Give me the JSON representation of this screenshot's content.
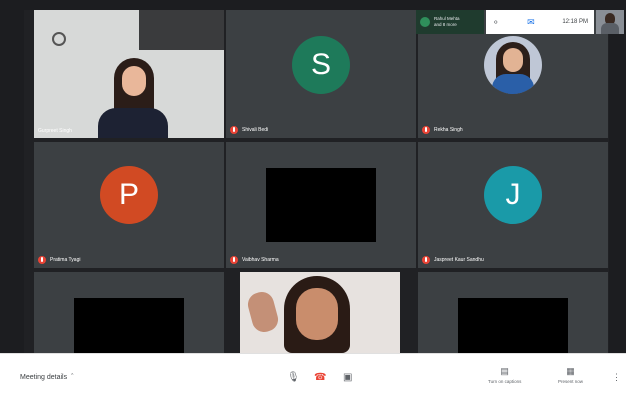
{
  "participants": [
    {
      "name": "Gurpreet Singh",
      "type": "video"
    },
    {
      "name": "Shivali Bedi",
      "type": "avatar",
      "initial": "S",
      "color": "#1e7a5a"
    },
    {
      "name": "Rekha Singh",
      "type": "photo"
    },
    {
      "name": "Pratima Tyagi",
      "type": "avatar",
      "initial": "P",
      "color": "#d14a23"
    },
    {
      "name": "Vaibhav Sharma",
      "type": "video-off"
    },
    {
      "name": "Jaspreet Kaur Sandhu",
      "type": "avatar",
      "initial": "J",
      "color": "#1a9aa8"
    }
  ],
  "notification": {
    "text_line1": "Rahul Mehta",
    "text_line2": "and 8 more"
  },
  "topbar": {
    "time": "12:18 PM"
  },
  "bottombar": {
    "meeting_details": "Meeting details",
    "captions_label": "Turn on captions",
    "present_label": "Present now"
  }
}
